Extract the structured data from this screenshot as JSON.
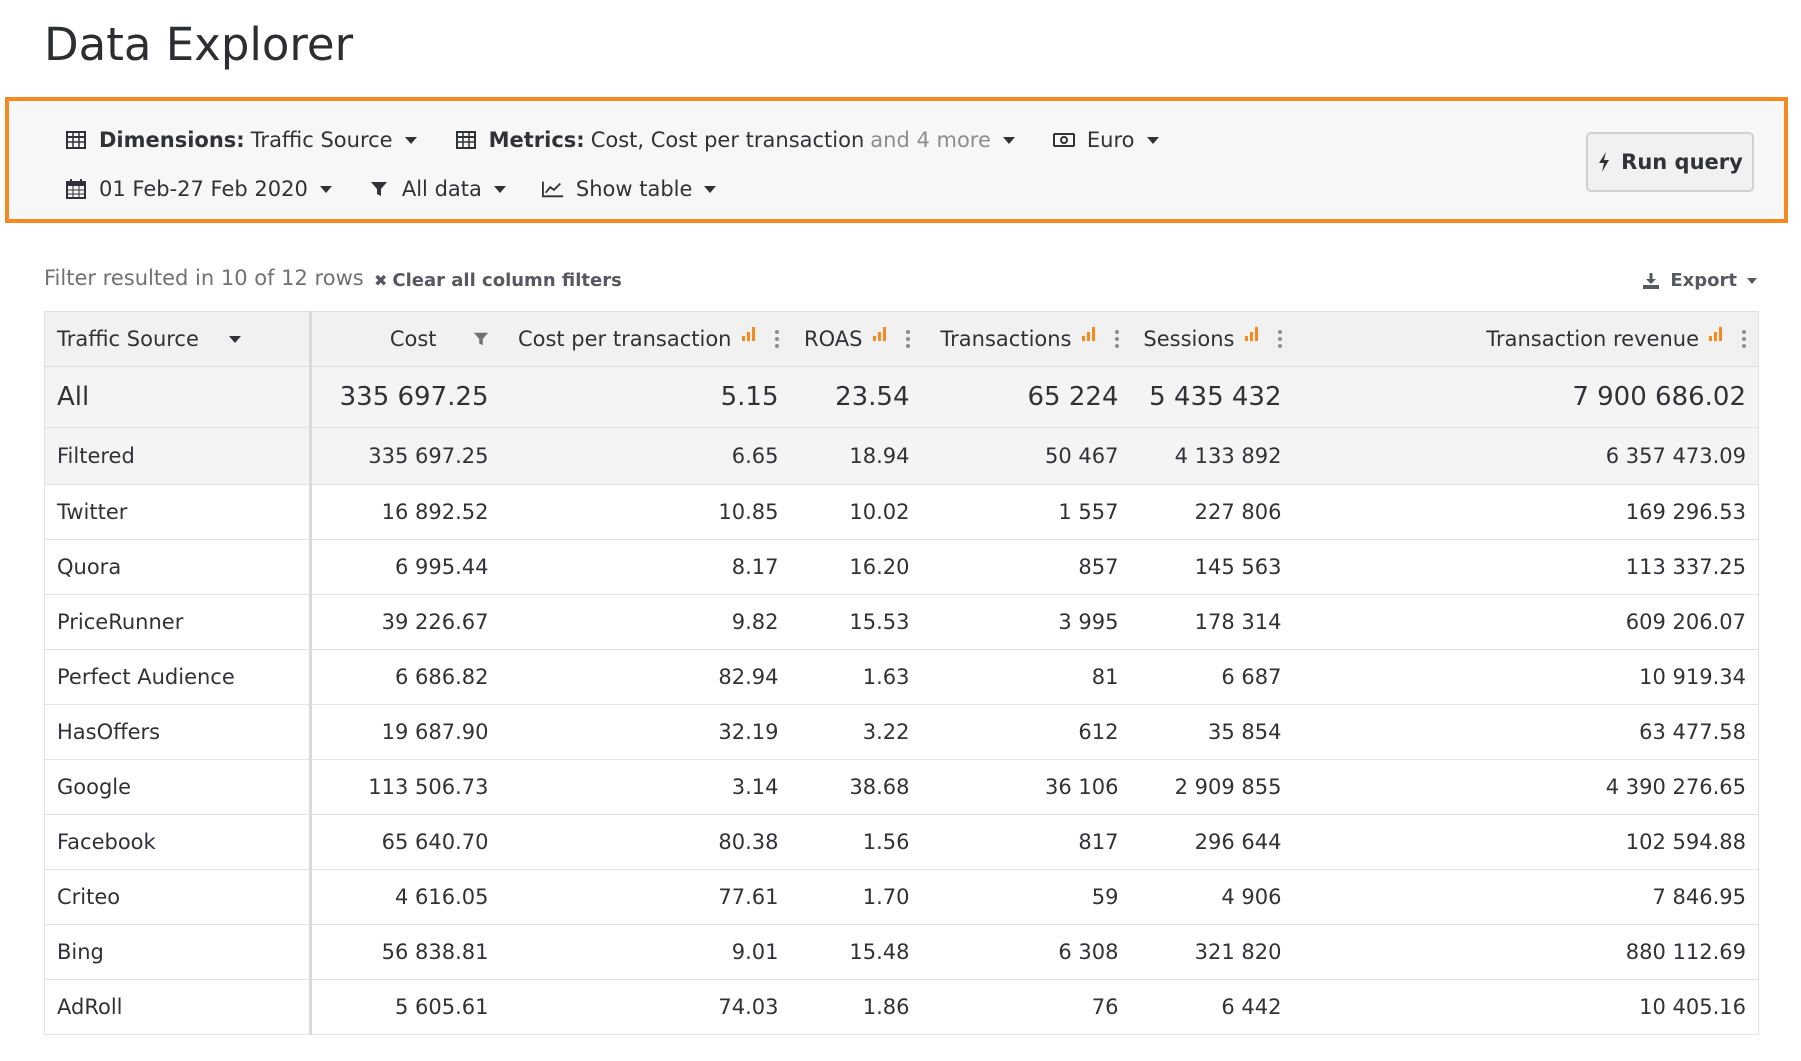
{
  "page": {
    "title": "Data Explorer"
  },
  "query": {
    "dimensions_label": "Dimensions:",
    "dimensions_value": "Traffic Source",
    "metrics_label": "Metrics:",
    "metrics_value": "Cost, Cost per transaction",
    "metrics_more": "and 4 more",
    "currency": "Euro",
    "date_range": "01 Feb-27 Feb 2020",
    "filter": "All data",
    "view": "Show table",
    "run_label": "Run query"
  },
  "toolbar": {
    "filter_status": "Filter resulted in 10 of 12 rows",
    "clear_filters": "Clear all column filters",
    "export": "Export"
  },
  "colors": {
    "accent": "#f6891f"
  },
  "table": {
    "columns": [
      "Traffic Source",
      "Cost",
      "Cost per transaction",
      "ROAS",
      "Transactions",
      "Sessions",
      "Transaction revenue"
    ],
    "summary": [
      {
        "label": "All",
        "values": [
          "335 697.25",
          "5.15",
          "23.54",
          "65 224",
          "5 435 432",
          "7 900 686.02"
        ]
      },
      {
        "label": "Filtered",
        "values": [
          "335 697.25",
          "6.65",
          "18.94",
          "50 467",
          "4 133 892",
          "6 357 473.09"
        ]
      }
    ],
    "rows": [
      {
        "label": "Twitter",
        "values": [
          "16 892.52",
          "10.85",
          "10.02",
          "1 557",
          "227 806",
          "169 296.53"
        ]
      },
      {
        "label": "Quora",
        "values": [
          "6 995.44",
          "8.17",
          "16.20",
          "857",
          "145 563",
          "113 337.25"
        ]
      },
      {
        "label": "PriceRunner",
        "values": [
          "39 226.67",
          "9.82",
          "15.53",
          "3 995",
          "178 314",
          "609 206.07"
        ]
      },
      {
        "label": "Perfect Audience",
        "values": [
          "6 686.82",
          "82.94",
          "1.63",
          "81",
          "6 687",
          "10 919.34"
        ]
      },
      {
        "label": "HasOffers",
        "values": [
          "19 687.90",
          "32.19",
          "3.22",
          "612",
          "35 854",
          "63 477.58"
        ]
      },
      {
        "label": "Google",
        "values": [
          "113 506.73",
          "3.14",
          "38.68",
          "36 106",
          "2 909 855",
          "4 390 276.65"
        ]
      },
      {
        "label": "Facebook",
        "values": [
          "65 640.70",
          "80.38",
          "1.56",
          "817",
          "296 644",
          "102 594.88"
        ]
      },
      {
        "label": "Criteo",
        "values": [
          "4 616.05",
          "77.61",
          "1.70",
          "59",
          "4 906",
          "7 846.95"
        ]
      },
      {
        "label": "Bing",
        "values": [
          "56 838.81",
          "9.01",
          "15.48",
          "6 308",
          "321 820",
          "880 112.69"
        ]
      },
      {
        "label": "AdRoll",
        "values": [
          "5 605.61",
          "74.03",
          "1.86",
          "76",
          "6 442",
          "10 405.16"
        ]
      }
    ]
  }
}
